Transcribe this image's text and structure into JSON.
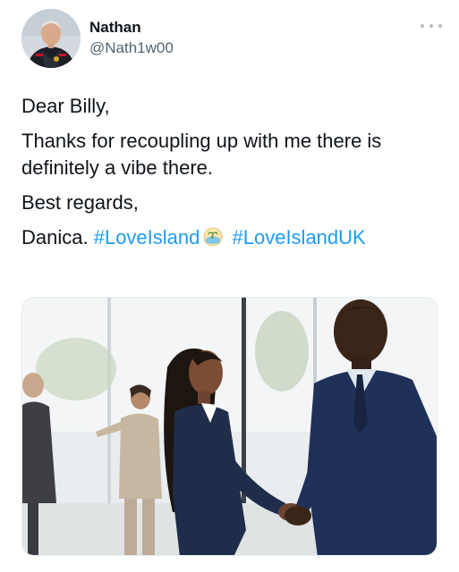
{
  "tweet": {
    "author": {
      "display_name": "Nathan",
      "handle": "@Nath1w00",
      "avatar_icon": "profile-photo-icon"
    },
    "more_icon": "ellipsis-icon",
    "lines": {
      "greeting": "Dear Billy,",
      "message": "Thanks for recoupling up with me there is definitely a vibe there.",
      "closing": "Best regards,",
      "signature": "Danica."
    },
    "hashtags": [
      "#LoveIsland",
      "#LoveIslandUK"
    ],
    "hashtag_emoji": "love-island-emoji-icon",
    "media": {
      "description_icon": "business-handshake-photo"
    },
    "colors": {
      "hashtag": "#1d9bf0",
      "text": "#0f1419",
      "secondary": "#536471"
    }
  }
}
